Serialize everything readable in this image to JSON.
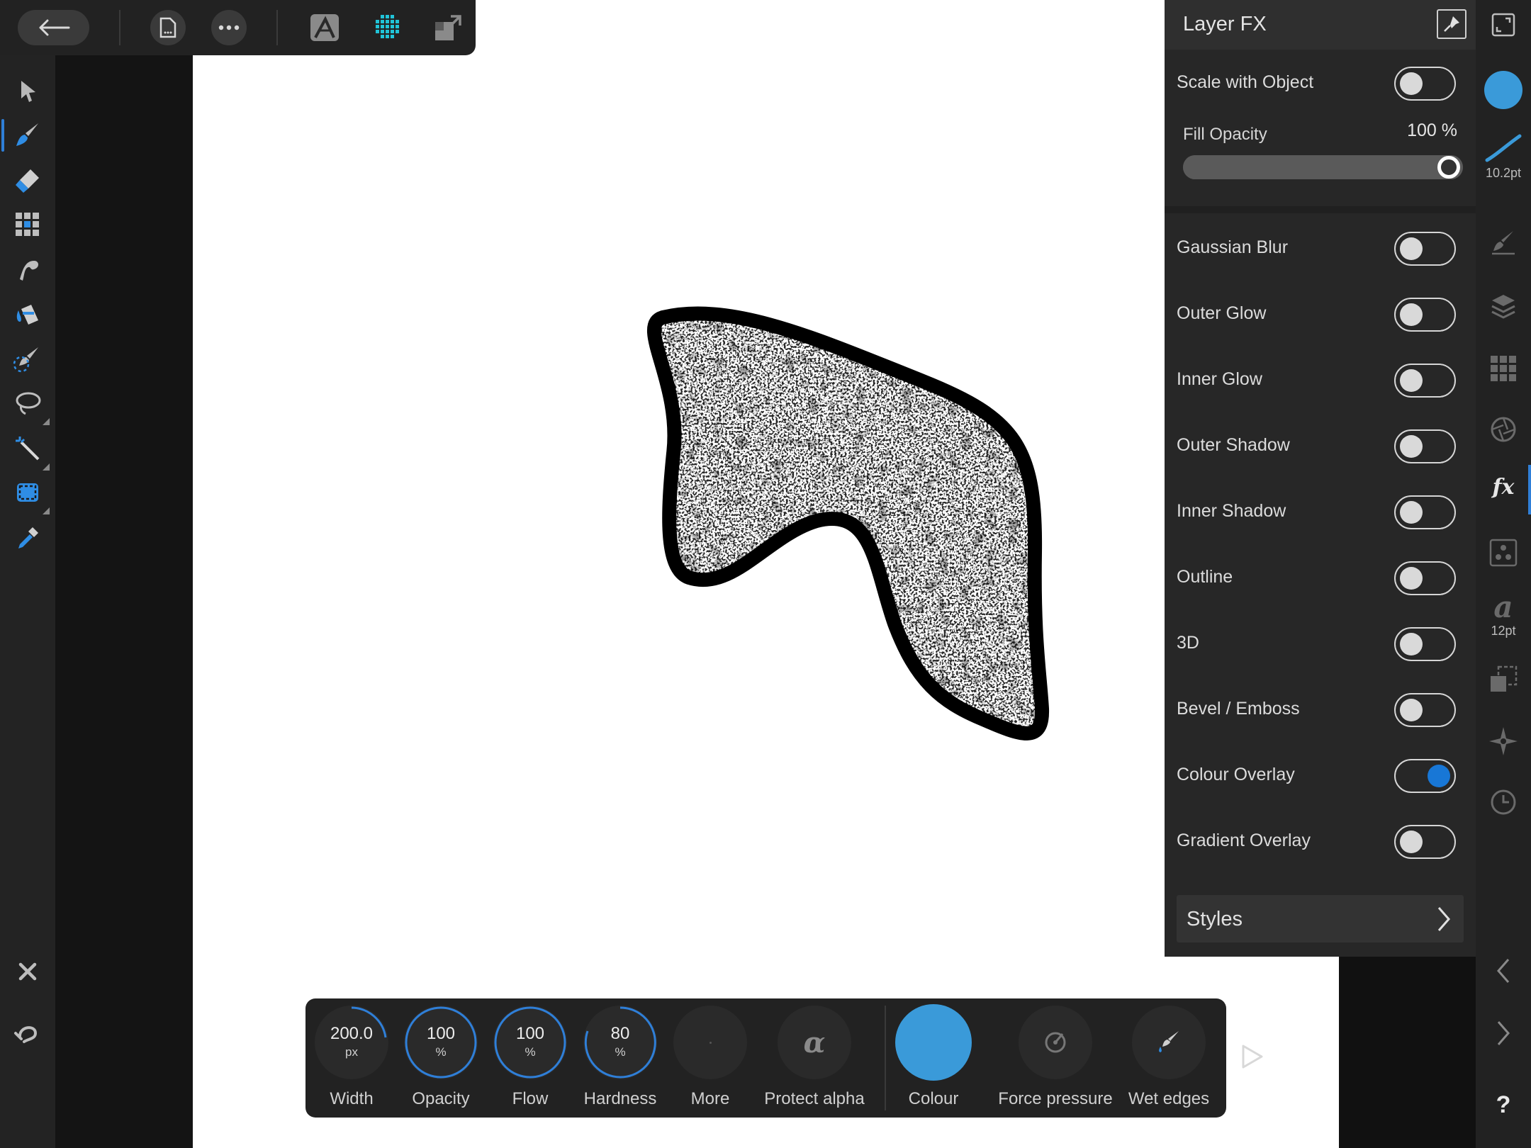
{
  "top_toolbar": {
    "back_icon": "arrow-left-icon",
    "document_icon": "document-icon",
    "more_icon": "ellipsis-icon",
    "persona_icon": "affinity-persona-icon",
    "pixel_persona_icon": "pixel-grid-persona-icon",
    "export_persona_icon": "export-persona-icon",
    "accent": "#20c4d8"
  },
  "left_tools": [
    {
      "name": "move-tool",
      "icon": "arrow-pointer-icon"
    },
    {
      "name": "paint-brush-tool",
      "icon": "paint-brush-icon",
      "active": true
    },
    {
      "name": "erase-brush-tool",
      "icon": "eraser-icon"
    },
    {
      "name": "pixel-tool",
      "icon": "pixel-grid-icon"
    },
    {
      "name": "smudge-tool",
      "icon": "smudge-icon"
    },
    {
      "name": "flood-fill-tool",
      "icon": "paint-bucket-icon"
    },
    {
      "name": "selection-brush-tool",
      "icon": "selection-brush-icon"
    },
    {
      "name": "lasso-tool",
      "icon": "lasso-icon"
    },
    {
      "name": "magic-wand-tool",
      "icon": "magic-wand-icon"
    },
    {
      "name": "marquee-tool",
      "icon": "marquee-icon"
    },
    {
      "name": "colour-picker-tool",
      "icon": "eyedropper-icon"
    }
  ],
  "left_bottom": [
    {
      "name": "close-action",
      "icon": "close-icon"
    },
    {
      "name": "undo-action",
      "icon": "undo-icon"
    },
    {
      "name": "delete-action",
      "icon": "trash-icon"
    }
  ],
  "layer_fx": {
    "title": "Layer FX",
    "pin_icon": "pin-icon",
    "scale_with_object": {
      "label": "Scale with Object",
      "on": false
    },
    "fill_opacity": {
      "label": "Fill Opacity",
      "value_text": "100 %",
      "value": 1.0
    },
    "effects": [
      {
        "label": "Gaussian Blur",
        "on": false
      },
      {
        "label": "Outer Glow",
        "on": false
      },
      {
        "label": "Inner Glow",
        "on": false
      },
      {
        "label": "Outer Shadow",
        "on": false
      },
      {
        "label": "Inner Shadow",
        "on": false
      },
      {
        "label": "Outline",
        "on": false
      },
      {
        "label": "3D",
        "on": false
      },
      {
        "label": "Bevel / Emboss",
        "on": false
      },
      {
        "label": "Colour Overlay",
        "on": true
      },
      {
        "label": "Gradient Overlay",
        "on": false
      }
    ],
    "styles": {
      "label": "Styles",
      "icon": "chevron-right-icon"
    }
  },
  "studio_bar": {
    "stroke_width": "10.2pt",
    "text_size": "12pt",
    "text_glyph": "a",
    "fx_glyph": "fx",
    "help_glyph": "?",
    "colour": "#3a9ad9"
  },
  "context_toolbar": {
    "width": {
      "value": "200.0",
      "unit": "px",
      "label": "Width"
    },
    "opacity": {
      "value": "100",
      "unit": "%",
      "label": "Opacity"
    },
    "flow": {
      "value": "100",
      "unit": "%",
      "label": "Flow"
    },
    "hardness": {
      "value": "80",
      "unit": "%",
      "label": "Hardness"
    },
    "more": {
      "label": "More"
    },
    "protect_alpha": {
      "glyph": "α",
      "label": "Protect alpha"
    },
    "colour": {
      "label": "Colour",
      "value": "#3a9ad9"
    },
    "force_pressure": {
      "label": "Force pressure"
    },
    "wet_edges": {
      "label": "Wet edges"
    }
  },
  "colors": {
    "accent_blue": "#2f7fd8",
    "toggle_on": "#1877d6",
    "colour_swatch": "#3a9ad9"
  }
}
